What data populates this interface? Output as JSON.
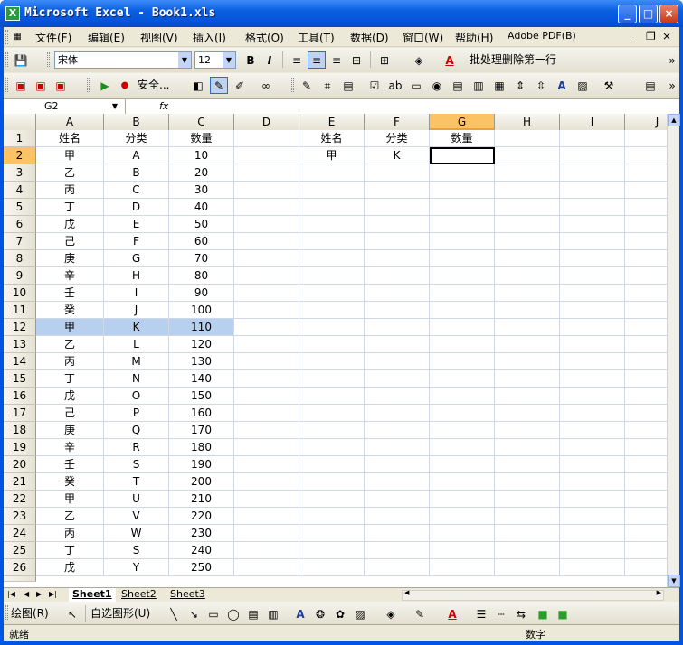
{
  "window": {
    "title": "Microsoft Excel - Book1.xls",
    "buttons": [
      "_",
      "□",
      "×"
    ]
  },
  "menu": [
    "文件(F)",
    "编辑(E)",
    "视图(V)",
    "插入(I)",
    "格式(O)",
    "工具(T)",
    "数据(D)",
    "窗口(W)",
    "帮助(H)",
    "Adobe PDF(B)"
  ],
  "toolbar1": {
    "font_name": "宋体",
    "font_size": "12",
    "bold": "B",
    "italic": "I",
    "macro_label": "批处理删除第一行"
  },
  "toolbar2": {
    "security_label": "安全..."
  },
  "formula_bar": {
    "name_box": "G2",
    "fx": "fx",
    "formula": ""
  },
  "columns": [
    "A",
    "B",
    "C",
    "D",
    "E",
    "F",
    "G",
    "H",
    "I",
    "J"
  ],
  "selected_column": "G",
  "active_cell": "G2",
  "highlighted_row": 12,
  "rows": [
    {
      "n": "1",
      "A": "姓名",
      "B": "分类",
      "C": "数量",
      "E": "姓名",
      "F": "分类",
      "G": "数量"
    },
    {
      "n": "2",
      "A": "甲",
      "B": "A",
      "C": "10",
      "E": "甲",
      "F": "K",
      "G": ""
    },
    {
      "n": "3",
      "A": "乙",
      "B": "B",
      "C": "20"
    },
    {
      "n": "4",
      "A": "丙",
      "B": "C",
      "C": "30"
    },
    {
      "n": "5",
      "A": "丁",
      "B": "D",
      "C": "40"
    },
    {
      "n": "6",
      "A": "戊",
      "B": "E",
      "C": "50"
    },
    {
      "n": "7",
      "A": "己",
      "B": "F",
      "C": "60"
    },
    {
      "n": "8",
      "A": "庚",
      "B": "G",
      "C": "70"
    },
    {
      "n": "9",
      "A": "辛",
      "B": "H",
      "C": "80"
    },
    {
      "n": "10",
      "A": "壬",
      "B": "I",
      "C": "90"
    },
    {
      "n": "11",
      "A": "癸",
      "B": "J",
      "C": "100"
    },
    {
      "n": "12",
      "A": "甲",
      "B": "K",
      "C": "110"
    },
    {
      "n": "13",
      "A": "乙",
      "B": "L",
      "C": "120"
    },
    {
      "n": "14",
      "A": "丙",
      "B": "M",
      "C": "130"
    },
    {
      "n": "15",
      "A": "丁",
      "B": "N",
      "C": "140"
    },
    {
      "n": "16",
      "A": "戊",
      "B": "O",
      "C": "150"
    },
    {
      "n": "17",
      "A": "己",
      "B": "P",
      "C": "160"
    },
    {
      "n": "18",
      "A": "庚",
      "B": "Q",
      "C": "170"
    },
    {
      "n": "19",
      "A": "辛",
      "B": "R",
      "C": "180"
    },
    {
      "n": "20",
      "A": "壬",
      "B": "S",
      "C": "190"
    },
    {
      "n": "21",
      "A": "癸",
      "B": "T",
      "C": "200"
    },
    {
      "n": "22",
      "A": "甲",
      "B": "U",
      "C": "210"
    },
    {
      "n": "23",
      "A": "乙",
      "B": "V",
      "C": "220"
    },
    {
      "n": "24",
      "A": "丙",
      "B": "W",
      "C": "230"
    },
    {
      "n": "25",
      "A": "丁",
      "B": "S",
      "C": "240"
    },
    {
      "n": "26",
      "A": "戊",
      "B": "Y",
      "C": "250"
    }
  ],
  "sheets": [
    "Sheet1",
    "Sheet2",
    "Sheet3"
  ],
  "active_sheet": "Sheet1",
  "drawbar": {
    "draw_label": "绘图(R)",
    "autoshapes_label": "自选图形(U)"
  },
  "status": {
    "left": "就绪",
    "right": "数字"
  },
  "colors": {
    "titlebar": "#0054e3",
    "selected_header": "#f9c366",
    "highlight_row": "#b8d0f0"
  }
}
